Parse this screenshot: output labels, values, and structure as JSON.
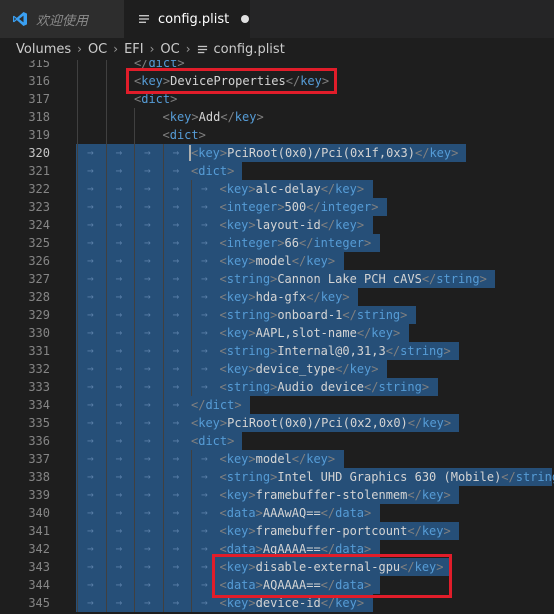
{
  "tabs": [
    {
      "label": "欢迎使用",
      "icon": "vscode-logo-icon",
      "active": false
    },
    {
      "label": "config.plist",
      "icon": "file-lines-icon",
      "active": true,
      "dirty": true
    }
  ],
  "breadcrumb": [
    "Volumes",
    "OC",
    "EFI",
    "OC",
    "config.plist"
  ],
  "editor": {
    "lines": [
      {
        "n": "315",
        "indent": 2,
        "sel": false,
        "segs": [
          {
            "c": "angle",
            "t": "</"
          },
          {
            "c": "tag",
            "t": "dict"
          },
          {
            "c": "angle",
            "t": ">"
          }
        ]
      },
      {
        "n": "316",
        "indent": 2,
        "sel": false,
        "segs": [
          {
            "c": "angle",
            "t": "<"
          },
          {
            "c": "tag",
            "t": "key"
          },
          {
            "c": "angle",
            "t": ">"
          },
          {
            "c": "txt",
            "t": "DeviceProperties"
          },
          {
            "c": "angle",
            "t": "</"
          },
          {
            "c": "tag",
            "t": "key"
          },
          {
            "c": "angle",
            "t": ">"
          }
        ]
      },
      {
        "n": "317",
        "indent": 2,
        "sel": false,
        "segs": [
          {
            "c": "angle",
            "t": "<"
          },
          {
            "c": "tag",
            "t": "dict"
          },
          {
            "c": "angle",
            "t": ">"
          }
        ]
      },
      {
        "n": "318",
        "indent": 3,
        "sel": false,
        "segs": [
          {
            "c": "angle",
            "t": "<"
          },
          {
            "c": "tag",
            "t": "key"
          },
          {
            "c": "angle",
            "t": ">"
          },
          {
            "c": "txt",
            "t": "Add"
          },
          {
            "c": "angle",
            "t": "</"
          },
          {
            "c": "tag",
            "t": "key"
          },
          {
            "c": "angle",
            "t": ">"
          }
        ]
      },
      {
        "n": "319",
        "indent": 3,
        "sel": false,
        "segs": [
          {
            "c": "angle",
            "t": "<"
          },
          {
            "c": "tag",
            "t": "dict"
          },
          {
            "c": "angle",
            "t": ">"
          }
        ]
      },
      {
        "n": "320",
        "indent": 4,
        "sel": true,
        "cursor": true,
        "segs": [
          {
            "c": "angle",
            "t": "<"
          },
          {
            "c": "tag",
            "t": "key"
          },
          {
            "c": "angle",
            "t": ">"
          },
          {
            "c": "txt",
            "t": "PciRoot(0x0)/Pci(0x1f,0x3)"
          },
          {
            "c": "angle",
            "t": "</"
          },
          {
            "c": "tag",
            "t": "key"
          },
          {
            "c": "angle",
            "t": ">"
          }
        ]
      },
      {
        "n": "321",
        "indent": 4,
        "sel": true,
        "segs": [
          {
            "c": "angle",
            "t": "<"
          },
          {
            "c": "tag",
            "t": "dict"
          },
          {
            "c": "angle",
            "t": ">"
          }
        ]
      },
      {
        "n": "322",
        "indent": 5,
        "sel": true,
        "segs": [
          {
            "c": "angle",
            "t": "<"
          },
          {
            "c": "tag",
            "t": "key"
          },
          {
            "c": "angle",
            "t": ">"
          },
          {
            "c": "txt",
            "t": "alc-delay"
          },
          {
            "c": "angle",
            "t": "</"
          },
          {
            "c": "tag",
            "t": "key"
          },
          {
            "c": "angle",
            "t": ">"
          }
        ]
      },
      {
        "n": "323",
        "indent": 5,
        "sel": true,
        "segs": [
          {
            "c": "angle",
            "t": "<"
          },
          {
            "c": "tag",
            "t": "integer"
          },
          {
            "c": "angle",
            "t": ">"
          },
          {
            "c": "txt",
            "t": "500"
          },
          {
            "c": "angle",
            "t": "</"
          },
          {
            "c": "tag",
            "t": "integer"
          },
          {
            "c": "angle",
            "t": ">"
          }
        ]
      },
      {
        "n": "324",
        "indent": 5,
        "sel": true,
        "segs": [
          {
            "c": "angle",
            "t": "<"
          },
          {
            "c": "tag",
            "t": "key"
          },
          {
            "c": "angle",
            "t": ">"
          },
          {
            "c": "txt",
            "t": "layout-id"
          },
          {
            "c": "angle",
            "t": "</"
          },
          {
            "c": "tag",
            "t": "key"
          },
          {
            "c": "angle",
            "t": ">"
          }
        ]
      },
      {
        "n": "325",
        "indent": 5,
        "sel": true,
        "segs": [
          {
            "c": "angle",
            "t": "<"
          },
          {
            "c": "tag",
            "t": "integer"
          },
          {
            "c": "angle",
            "t": ">"
          },
          {
            "c": "txt",
            "t": "66"
          },
          {
            "c": "angle",
            "t": "</"
          },
          {
            "c": "tag",
            "t": "integer"
          },
          {
            "c": "angle",
            "t": ">"
          }
        ]
      },
      {
        "n": "326",
        "indent": 5,
        "sel": true,
        "segs": [
          {
            "c": "angle",
            "t": "<"
          },
          {
            "c": "tag",
            "t": "key"
          },
          {
            "c": "angle",
            "t": ">"
          },
          {
            "c": "txt",
            "t": "model"
          },
          {
            "c": "angle",
            "t": "</"
          },
          {
            "c": "tag",
            "t": "key"
          },
          {
            "c": "angle",
            "t": ">"
          }
        ]
      },
      {
        "n": "327",
        "indent": 5,
        "sel": true,
        "segs": [
          {
            "c": "angle",
            "t": "<"
          },
          {
            "c": "tag",
            "t": "string"
          },
          {
            "c": "angle",
            "t": ">"
          },
          {
            "c": "txt",
            "t": "Cannon Lake PCH cAVS"
          },
          {
            "c": "angle",
            "t": "</"
          },
          {
            "c": "tag",
            "t": "string"
          },
          {
            "c": "angle",
            "t": ">"
          }
        ]
      },
      {
        "n": "328",
        "indent": 5,
        "sel": true,
        "segs": [
          {
            "c": "angle",
            "t": "<"
          },
          {
            "c": "tag",
            "t": "key"
          },
          {
            "c": "angle",
            "t": ">"
          },
          {
            "c": "txt",
            "t": "hda-gfx"
          },
          {
            "c": "angle",
            "t": "</"
          },
          {
            "c": "tag",
            "t": "key"
          },
          {
            "c": "angle",
            "t": ">"
          }
        ]
      },
      {
        "n": "329",
        "indent": 5,
        "sel": true,
        "segs": [
          {
            "c": "angle",
            "t": "<"
          },
          {
            "c": "tag",
            "t": "string"
          },
          {
            "c": "angle",
            "t": ">"
          },
          {
            "c": "txt",
            "t": "onboard-1"
          },
          {
            "c": "angle",
            "t": "</"
          },
          {
            "c": "tag",
            "t": "string"
          },
          {
            "c": "angle",
            "t": ">"
          }
        ]
      },
      {
        "n": "330",
        "indent": 5,
        "sel": true,
        "segs": [
          {
            "c": "angle",
            "t": "<"
          },
          {
            "c": "tag",
            "t": "key"
          },
          {
            "c": "angle",
            "t": ">"
          },
          {
            "c": "txt",
            "t": "AAPL,slot-name"
          },
          {
            "c": "angle",
            "t": "</"
          },
          {
            "c": "tag",
            "t": "key"
          },
          {
            "c": "angle",
            "t": ">"
          }
        ]
      },
      {
        "n": "331",
        "indent": 5,
        "sel": true,
        "segs": [
          {
            "c": "angle",
            "t": "<"
          },
          {
            "c": "tag",
            "t": "string"
          },
          {
            "c": "angle",
            "t": ">"
          },
          {
            "c": "txt",
            "t": "Internal@0,31,3"
          },
          {
            "c": "angle",
            "t": "</"
          },
          {
            "c": "tag",
            "t": "string"
          },
          {
            "c": "angle",
            "t": ">"
          }
        ]
      },
      {
        "n": "332",
        "indent": 5,
        "sel": true,
        "segs": [
          {
            "c": "angle",
            "t": "<"
          },
          {
            "c": "tag",
            "t": "key"
          },
          {
            "c": "angle",
            "t": ">"
          },
          {
            "c": "txt",
            "t": "device_type"
          },
          {
            "c": "angle",
            "t": "</"
          },
          {
            "c": "tag",
            "t": "key"
          },
          {
            "c": "angle",
            "t": ">"
          }
        ]
      },
      {
        "n": "333",
        "indent": 5,
        "sel": true,
        "segs": [
          {
            "c": "angle",
            "t": "<"
          },
          {
            "c": "tag",
            "t": "string"
          },
          {
            "c": "angle",
            "t": ">"
          },
          {
            "c": "txt",
            "t": "Audio device"
          },
          {
            "c": "angle",
            "t": "</"
          },
          {
            "c": "tag",
            "t": "string"
          },
          {
            "c": "angle",
            "t": ">"
          }
        ]
      },
      {
        "n": "334",
        "indent": 4,
        "sel": true,
        "segs": [
          {
            "c": "angle",
            "t": "</"
          },
          {
            "c": "tag",
            "t": "dict"
          },
          {
            "c": "angle",
            "t": ">"
          }
        ]
      },
      {
        "n": "335",
        "indent": 4,
        "sel": true,
        "segs": [
          {
            "c": "angle",
            "t": "<"
          },
          {
            "c": "tag",
            "t": "key"
          },
          {
            "c": "angle",
            "t": ">"
          },
          {
            "c": "txt",
            "t": "PciRoot(0x0)/Pci(0x2,0x0)"
          },
          {
            "c": "angle",
            "t": "</"
          },
          {
            "c": "tag",
            "t": "key"
          },
          {
            "c": "angle",
            "t": ">"
          }
        ]
      },
      {
        "n": "336",
        "indent": 4,
        "sel": true,
        "segs": [
          {
            "c": "angle",
            "t": "<"
          },
          {
            "c": "tag",
            "t": "dict"
          },
          {
            "c": "angle",
            "t": ">"
          }
        ]
      },
      {
        "n": "337",
        "indent": 5,
        "sel": true,
        "segs": [
          {
            "c": "angle",
            "t": "<"
          },
          {
            "c": "tag",
            "t": "key"
          },
          {
            "c": "angle",
            "t": ">"
          },
          {
            "c": "txt",
            "t": "model"
          },
          {
            "c": "angle",
            "t": "</"
          },
          {
            "c": "tag",
            "t": "key"
          },
          {
            "c": "angle",
            "t": ">"
          }
        ]
      },
      {
        "n": "338",
        "indent": 5,
        "sel": true,
        "segs": [
          {
            "c": "angle",
            "t": "<"
          },
          {
            "c": "tag",
            "t": "string"
          },
          {
            "c": "angle",
            "t": ">"
          },
          {
            "c": "txt",
            "t": "Intel UHD Graphics 630 (Mobile)"
          },
          {
            "c": "angle",
            "t": "</"
          },
          {
            "c": "tag",
            "t": "string"
          },
          {
            "c": "angle",
            "t": ">"
          }
        ]
      },
      {
        "n": "339",
        "indent": 5,
        "sel": true,
        "segs": [
          {
            "c": "angle",
            "t": "<"
          },
          {
            "c": "tag",
            "t": "key"
          },
          {
            "c": "angle",
            "t": ">"
          },
          {
            "c": "txt",
            "t": "framebuffer-stolenmem"
          },
          {
            "c": "angle",
            "t": "</"
          },
          {
            "c": "tag",
            "t": "key"
          },
          {
            "c": "angle",
            "t": ">"
          }
        ]
      },
      {
        "n": "340",
        "indent": 5,
        "sel": true,
        "segs": [
          {
            "c": "angle",
            "t": "<"
          },
          {
            "c": "tag",
            "t": "data"
          },
          {
            "c": "angle",
            "t": ">"
          },
          {
            "c": "txt",
            "t": "AAAwAQ=="
          },
          {
            "c": "angle",
            "t": "</"
          },
          {
            "c": "tag",
            "t": "data"
          },
          {
            "c": "angle",
            "t": ">"
          }
        ]
      },
      {
        "n": "341",
        "indent": 5,
        "sel": true,
        "segs": [
          {
            "c": "angle",
            "t": "<"
          },
          {
            "c": "tag",
            "t": "key"
          },
          {
            "c": "angle",
            "t": ">"
          },
          {
            "c": "txt",
            "t": "framebuffer-portcount"
          },
          {
            "c": "angle",
            "t": "</"
          },
          {
            "c": "tag",
            "t": "key"
          },
          {
            "c": "angle",
            "t": ">"
          }
        ]
      },
      {
        "n": "342",
        "indent": 5,
        "sel": true,
        "segs": [
          {
            "c": "angle",
            "t": "<"
          },
          {
            "c": "tag",
            "t": "data"
          },
          {
            "c": "angle",
            "t": ">"
          },
          {
            "c": "txt",
            "t": "AgAAAA=="
          },
          {
            "c": "angle",
            "t": "</"
          },
          {
            "c": "tag",
            "t": "data"
          },
          {
            "c": "angle",
            "t": ">"
          }
        ]
      },
      {
        "n": "343",
        "indent": 5,
        "sel": true,
        "segs": [
          {
            "c": "angle",
            "t": "<"
          },
          {
            "c": "tag",
            "t": "key"
          },
          {
            "c": "angle",
            "t": ">"
          },
          {
            "c": "txt",
            "t": "disable-external-gpu"
          },
          {
            "c": "angle",
            "t": "</"
          },
          {
            "c": "tag",
            "t": "key"
          },
          {
            "c": "angle",
            "t": ">"
          }
        ]
      },
      {
        "n": "344",
        "indent": 5,
        "sel": true,
        "segs": [
          {
            "c": "angle",
            "t": "<"
          },
          {
            "c": "tag",
            "t": "data"
          },
          {
            "c": "angle",
            "t": ">"
          },
          {
            "c": "txt",
            "t": "AQAAAA=="
          },
          {
            "c": "angle",
            "t": "</"
          },
          {
            "c": "tag",
            "t": "data"
          },
          {
            "c": "angle",
            "t": ">"
          }
        ]
      },
      {
        "n": "345",
        "indent": 5,
        "sel": true,
        "segs": [
          {
            "c": "angle",
            "t": "<"
          },
          {
            "c": "tag",
            "t": "key"
          },
          {
            "c": "angle",
            "t": ">"
          },
          {
            "c": "txt",
            "t": "device-id"
          },
          {
            "c": "angle",
            "t": "</"
          },
          {
            "c": "tag",
            "t": "key"
          },
          {
            "c": "angle",
            "t": ">"
          }
        ]
      }
    ],
    "highlights": [
      {
        "label": "highlight-deviceproperties",
        "lines": [
          "316"
        ]
      },
      {
        "label": "highlight-disable-external-gpu",
        "lines": [
          "343",
          "344"
        ]
      }
    ]
  },
  "colors": {
    "tag": "#569cd6",
    "angle": "#808080",
    "text": "#d4d4d4",
    "selection": "#264f78",
    "annotation": "#e11d2a"
  }
}
